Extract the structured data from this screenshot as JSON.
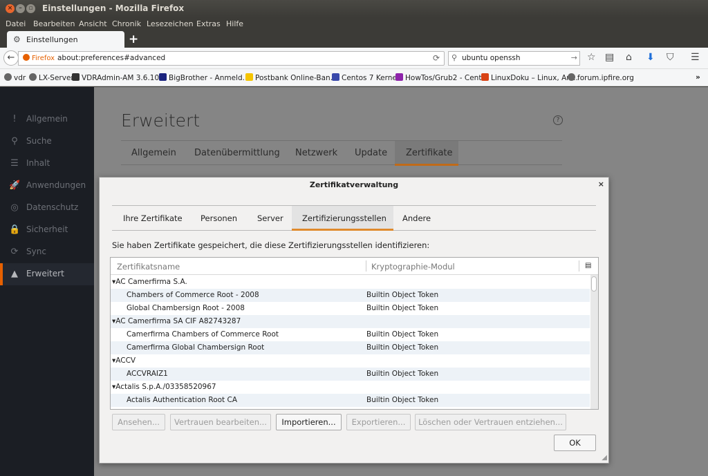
{
  "window": {
    "title": "Einstellungen - Mozilla Firefox"
  },
  "menubar": {
    "items": [
      "Datei",
      "Bearbeiten",
      "Ansicht",
      "Chronik",
      "Lesezeichen",
      "Extras",
      "Hilfe"
    ]
  },
  "tab": {
    "label": "Einstellungen",
    "icon": "gear-icon"
  },
  "navbar": {
    "identity_label": "Firefox",
    "url": "about:preferences#advanced",
    "search_value": "ubuntu openssh"
  },
  "bookmarks": [
    {
      "label": "vdr",
      "icon_color": "#666666"
    },
    {
      "label": "LX-Server",
      "icon_color": "#666666"
    },
    {
      "label": "VDRAdmin-AM 3.6.10...",
      "icon_color": "#333333"
    },
    {
      "label": "BigBrother - Anmeld...",
      "icon_color": "#1a237e"
    },
    {
      "label": "Postbank Online-Ban...",
      "icon_color": "#f5c400"
    },
    {
      "label": "Centos 7 Kernel",
      "icon_color": "#3949ab"
    },
    {
      "label": "HowTos/Grub2 - Cent...",
      "icon_color": "#8e24aa"
    },
    {
      "label": "LinuxDoku – Linux, An...",
      "icon_color": "#d84315"
    },
    {
      "label": "forum.ipfire.org",
      "icon_color": "#666666"
    }
  ],
  "sidebar": {
    "items": [
      {
        "label": "Allgemein",
        "icon": "!"
      },
      {
        "label": "Suche",
        "icon": "⚲"
      },
      {
        "label": "Inhalt",
        "icon": "☰"
      },
      {
        "label": "Anwendungen",
        "icon": "🚀"
      },
      {
        "label": "Datenschutz",
        "icon": "◎"
      },
      {
        "label": "Sicherheit",
        "icon": "🔒"
      },
      {
        "label": "Sync",
        "icon": "⟳"
      },
      {
        "label": "Erweitert",
        "icon": "▲",
        "active": true
      }
    ]
  },
  "prefs": {
    "title": "Erweitert",
    "help": "?",
    "tabs": [
      "Allgemein",
      "Datenübermittlung",
      "Netzwerk",
      "Update",
      "Zertifikate"
    ],
    "active_tab": "Zertifikate"
  },
  "dialog": {
    "title": "Zertifikatverwaltung",
    "close": "×",
    "tabs": [
      "Ihre Zertifikate",
      "Personen",
      "Server",
      "Zertifizierungsstellen",
      "Andere"
    ],
    "active_tab": "Zertifizierungsstellen",
    "description": "Sie haben Zertifikate gespeichert, die diese Zertifizierungsstellen identifizieren:",
    "columns": [
      "Zertifikatsname",
      "Kryptographie-Modul"
    ],
    "rows": [
      {
        "name": "▾AC Camerfirma S.A.",
        "module": "",
        "group": true
      },
      {
        "name": "Chambers of Commerce Root - 2008",
        "module": "Builtin Object Token",
        "group": false
      },
      {
        "name": "Global Chambersign Root - 2008",
        "module": "Builtin Object Token",
        "group": false
      },
      {
        "name": "▾AC Camerfirma SA CIF A82743287",
        "module": "",
        "group": true
      },
      {
        "name": "Camerfirma Chambers of Commerce Root",
        "module": "Builtin Object Token",
        "group": false
      },
      {
        "name": "Camerfirma Global Chambersign Root",
        "module": "Builtin Object Token",
        "group": false
      },
      {
        "name": "▾ACCV",
        "module": "",
        "group": true
      },
      {
        "name": "ACCVRAIZ1",
        "module": "Builtin Object Token",
        "group": false
      },
      {
        "name": "▾Actalis S.p.A./03358520967",
        "module": "",
        "group": true
      },
      {
        "name": "Actalis Authentication Root CA",
        "module": "Builtin Object Token",
        "group": false
      }
    ],
    "buttons": {
      "view": "Ansehen...",
      "edit_trust": "Vertrauen bearbeiten...",
      "import": "Importieren...",
      "export": "Exportieren...",
      "delete": "Löschen oder Vertrauen entziehen...",
      "ok": "OK"
    }
  },
  "colors": {
    "accent": "#e66000",
    "sidebar_bg": "#1b1e24",
    "titlebar": "#3c3b37"
  }
}
